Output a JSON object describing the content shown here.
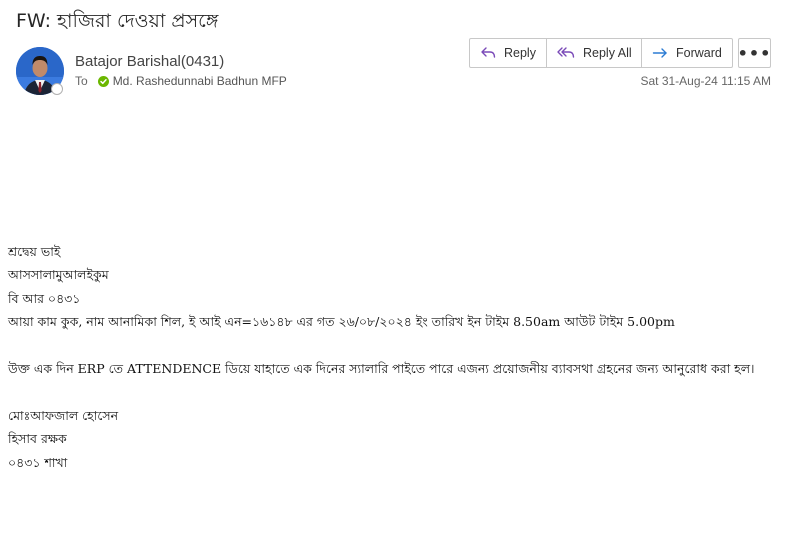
{
  "email": {
    "subject": "FW: হাজিরা দেওয়া প্রসঙ্গে",
    "sender": "Batajor Barishal(0431)",
    "to_label": "To",
    "recipient": "Md. Rashedunnabi Badhun MFP",
    "timestamp": "Sat 31-Aug-24 11:15 AM"
  },
  "actions": {
    "reply": "Reply",
    "reply_all": "Reply All",
    "forward": "Forward",
    "more": "•••"
  },
  "icons": {
    "reply": "reply-arrow-icon",
    "reply_all": "reply-all-arrow-icon",
    "forward": "forward-arrow-icon",
    "presence": "presence-status-icon",
    "recipient_status": "green-check-icon"
  },
  "colors": {
    "accent_icon": "#7a4ab8",
    "forward_icon": "#2b7bd3",
    "presence_online": "#6bb700"
  },
  "body": {
    "line1": "শ্রদ্বেয় ভাই",
    "line2": "আসসালামুআলইকুম",
    "line3": "বি আর ০৪৩১",
    "line4": "আয়া কাম কুক, নাম আনামিকা শিল, ই আই এন=১৬১৪৮ এর গত ২৬/০৮/২০২৪ ইং তারিখ ইন টাইম 8.50am আউট টাইম 5.00pm",
    "line5": "উক্ত এক দিন ERP তে ATTENDENCE ডিয়ে যাহাতে  এক দিনের স্যালারি পাইতে পারে এজন্য প্রয়োজনীয় ব্যাবসথা গ্রহনের জন্য আনুরোধ করা হল।",
    "sig1": "মোঃআফজাল হোসেন",
    "sig2": "হিসাব রক্ষক",
    "sig3": "০৪৩১ শাখা"
  }
}
